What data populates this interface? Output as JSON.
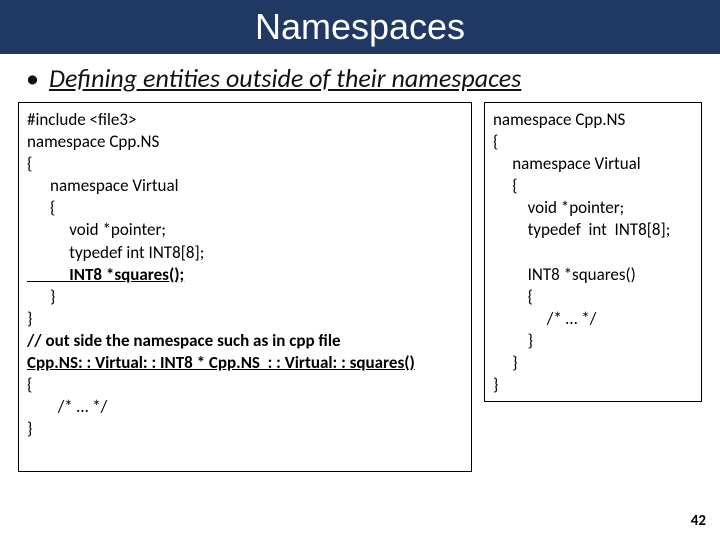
{
  "title": "Namespaces",
  "subtitle": "Defining entities outside of their namespaces",
  "left": {
    "l1": "#include <file3>",
    "l2": "namespace Cpp.NS",
    "l3": "{",
    "l4": "      namespace Virtual",
    "l5": "      {",
    "l6": "           void *pointer;",
    "l7": "           typedef int INT8[8];",
    "l8": "           INT8 *squares();",
    "l9": "      }",
    "l10": "}",
    "l11": "// out side the namespace such as in cpp file",
    "l12": "Cpp.NS: : Virtual: : INT8 * Cpp.NS  : : Virtual: : squares()",
    "l13": "{",
    "l14": "        /* … */",
    "l15": "}"
  },
  "right": {
    "r1": "namespace Cpp.NS",
    "r2": "{",
    "r3": "     namespace Virtual",
    "r4": "     {",
    "r5": "         void *pointer;",
    "r6": "         typedef  int  INT8[8];",
    "r7": "",
    "r8": "         INT8 *squares()",
    "r9": "         {",
    "r10": "              /* … */",
    "r11": "         }",
    "r12": "     }",
    "r13": "}"
  },
  "page_number": "42"
}
